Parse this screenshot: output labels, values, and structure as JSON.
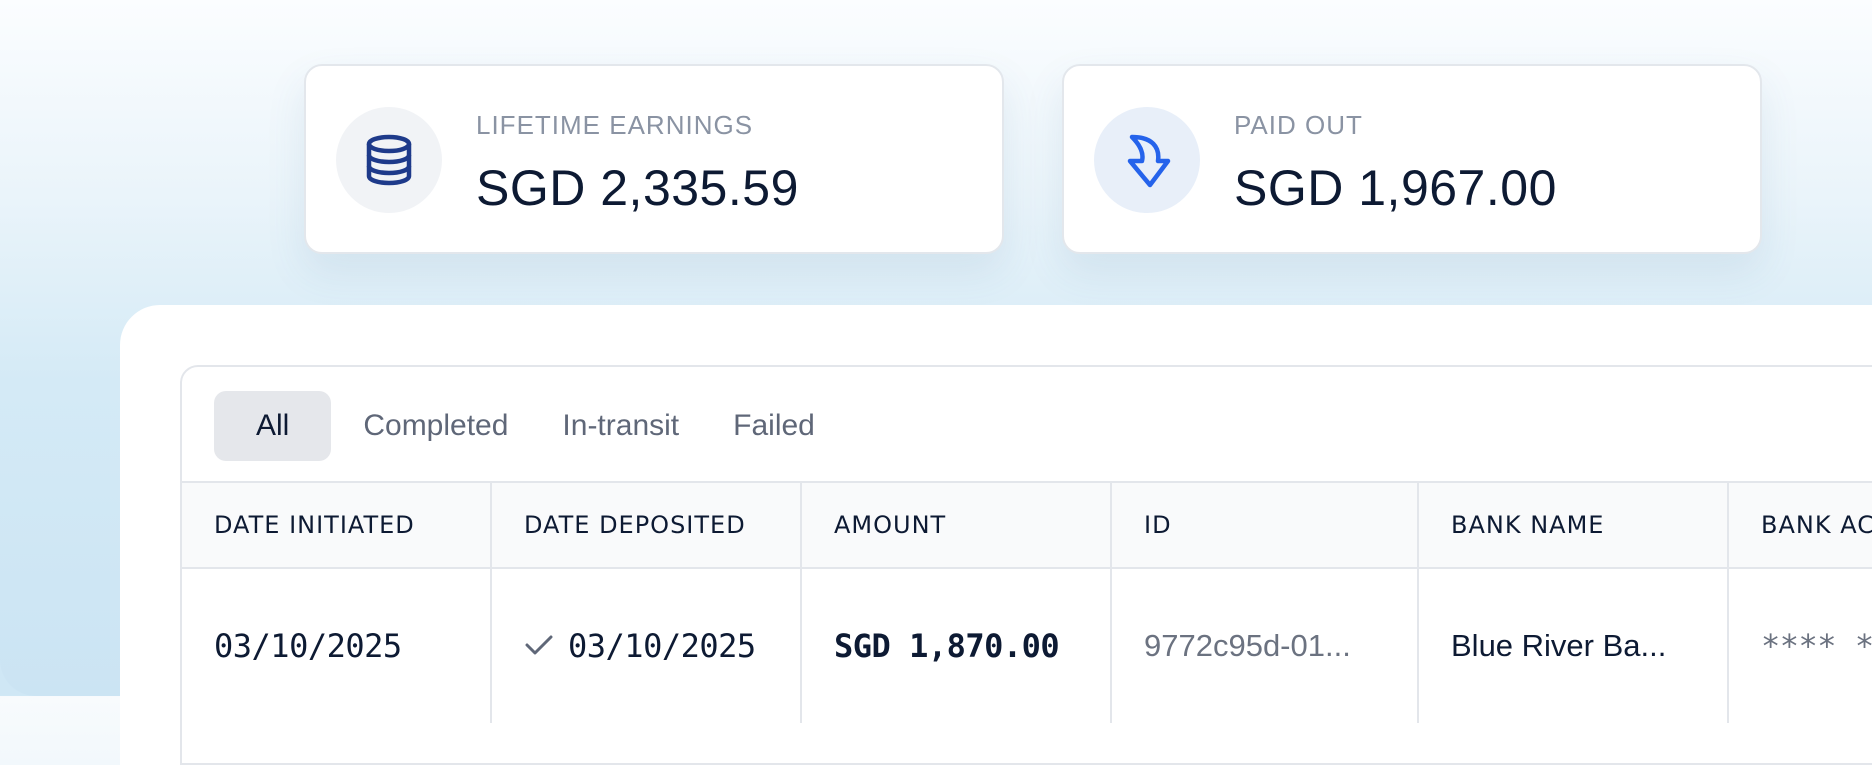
{
  "stats": [
    {
      "label": "LIFETIME EARNINGS",
      "value": "SGD 2,335.59",
      "icon": "database-coins-icon"
    },
    {
      "label": "PAID OUT",
      "value": "SGD 1,967.00",
      "icon": "curved-arrow-down-icon"
    }
  ],
  "tabs": [
    {
      "label": "All",
      "active": true
    },
    {
      "label": "Completed",
      "active": false
    },
    {
      "label": "In-transit",
      "active": false
    },
    {
      "label": "Failed",
      "active": false
    }
  ],
  "table": {
    "columns": [
      "DATE INITIATED",
      "DATE DEPOSITED",
      "AMOUNT",
      "ID",
      "BANK NAME",
      "BANK AC"
    ],
    "rows": [
      {
        "date_initiated": "03/10/2025",
        "date_deposited": "03/10/2025",
        "amount": "SGD 1,870.00",
        "id": "9772c95d-01...",
        "bank_name": "Blue River Ba...",
        "bank_account": "**** **"
      }
    ]
  },
  "colors": {
    "heading": "#0d1a33",
    "muted": "#8a93a3",
    "accent_blue": "#2563eb",
    "navy": "#1e3a8a",
    "active_tab_bg": "#e5e7eb"
  }
}
